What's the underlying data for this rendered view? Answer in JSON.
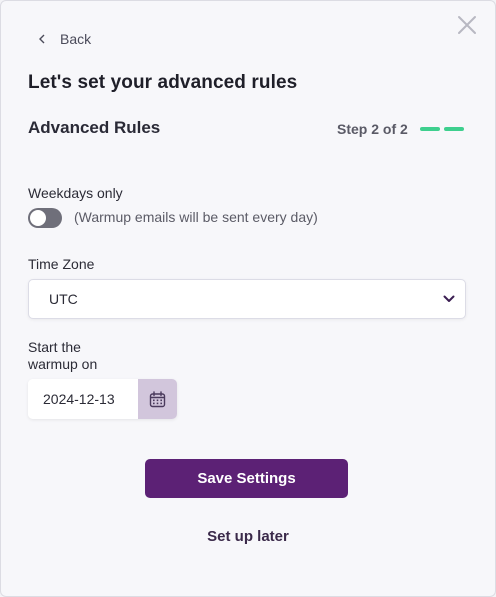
{
  "nav": {
    "back_label": "Back"
  },
  "header": {
    "title": "Let's set your advanced rules",
    "section_title": "Advanced Rules",
    "step_text": "Step 2 of 2",
    "step_color": "#3ecf8e"
  },
  "weekdays": {
    "label": "Weekdays only",
    "enabled": false,
    "description": "(Warmup emails will be sent every day)"
  },
  "timezone": {
    "label": "Time Zone",
    "selected": "UTC"
  },
  "start_date": {
    "label_line1": "Start the",
    "label_line2": "warmup on",
    "value": "2024-12-13"
  },
  "actions": {
    "save_label": "Save Settings",
    "later_label": "Set up later",
    "accent": "#5c2175"
  },
  "icons": {
    "close": "close-icon",
    "back": "chevron-left-icon",
    "select": "chevron-down-icon",
    "calendar": "calendar-icon"
  }
}
